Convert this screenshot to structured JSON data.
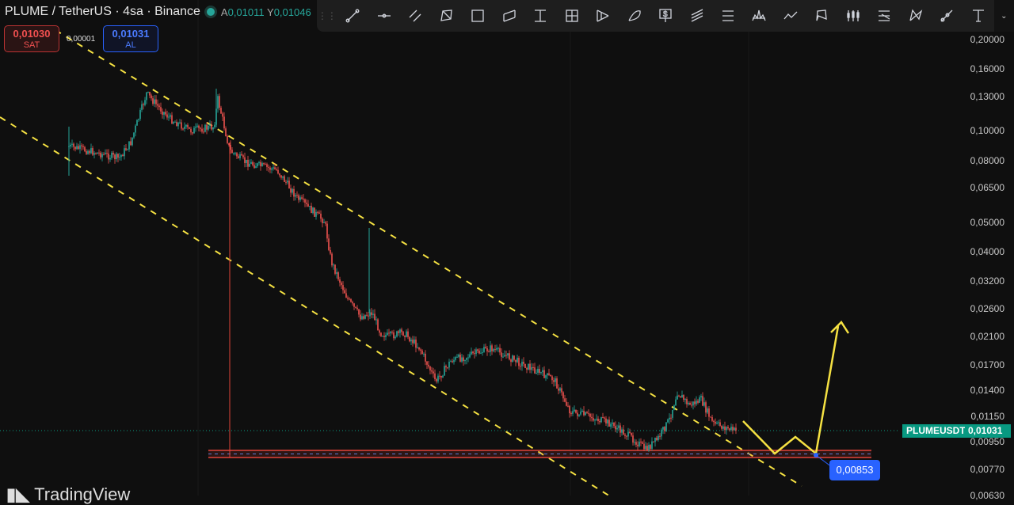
{
  "header": {
    "title": "PLUME / TetherUS · 4sa · Binance",
    "status_color": "#26a69a",
    "open_label": "A",
    "open_value": "0,01011",
    "high_label": "Y",
    "high_value": "0,01046"
  },
  "trade": {
    "sell_price": "0,01030",
    "sell_label": "SAT",
    "spread": "0,00001",
    "buy_price": "0,01031",
    "buy_label": "AL"
  },
  "toolbar": {
    "tools": [
      "trend-line",
      "horizontal-ray",
      "parallel-lines",
      "triangle",
      "rectangle",
      "parallel-channel",
      "price-range",
      "date-price-range",
      "pitchfan",
      "arc",
      "price-label",
      "fib-channel",
      "fib-retracement",
      "head-shoulders",
      "path",
      "xabcd",
      "long-position",
      "fib-time",
      "cypher-pattern",
      "info-line",
      "text"
    ]
  },
  "price_axis": {
    "scale": "log",
    "ticks": [
      "0,20000",
      "0,16000",
      "0,13000",
      "0,10000",
      "0,08000",
      "0,06500",
      "0,05000",
      "0,04000",
      "0,03200",
      "0,02600",
      "0,02100",
      "0,01700",
      "0,01400",
      "0,01150",
      "0,00950",
      "0,00770",
      "0,00630"
    ],
    "symbol": "PLUMEUSDT",
    "last_price": "0,01031",
    "last_color": "#089981"
  },
  "annotations": {
    "support_price": "0,00853",
    "channel_color": "#f5e142",
    "zone_color": "#e0443a",
    "label_color": "#2962ff"
  },
  "branding": {
    "logo": "TradingView"
  }
}
